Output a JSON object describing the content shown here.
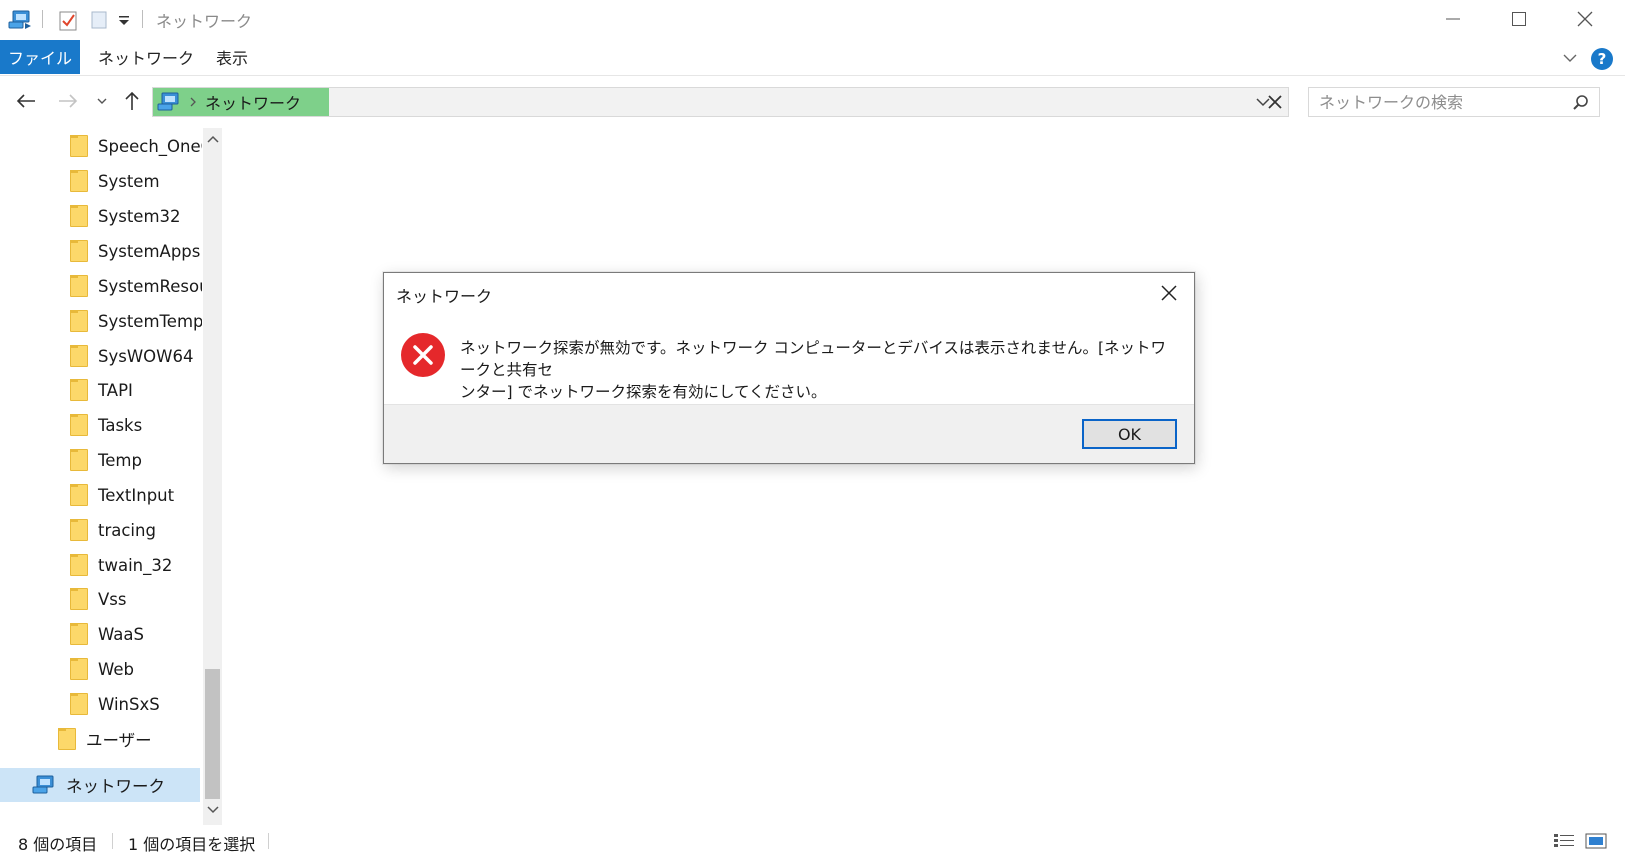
{
  "window": {
    "title": "ネットワーク"
  },
  "ribbon": {
    "tabs": [
      {
        "label": "ファイル",
        "active": true
      },
      {
        "label": "ネットワーク"
      },
      {
        "label": "表示"
      }
    ]
  },
  "navigation": {
    "breadcrumb": "ネットワーク",
    "search_placeholder": "ネットワークの検索"
  },
  "tree": {
    "items": [
      {
        "label": "Speech_OneC"
      },
      {
        "label": "System"
      },
      {
        "label": "System32"
      },
      {
        "label": "SystemApps"
      },
      {
        "label": "SystemResou"
      },
      {
        "label": "SystemTemp"
      },
      {
        "label": "SysWOW64"
      },
      {
        "label": "TAPI"
      },
      {
        "label": "Tasks"
      },
      {
        "label": "Temp"
      },
      {
        "label": "TextInput"
      },
      {
        "label": "tracing"
      },
      {
        "label": "twain_32"
      },
      {
        "label": "Vss"
      },
      {
        "label": "WaaS"
      },
      {
        "label": "Web"
      },
      {
        "label": "WinSxS"
      },
      {
        "label": "ユーザー"
      }
    ],
    "network_label": "ネットワーク"
  },
  "status": {
    "item_count": "8 個の項目",
    "selected": "1 個の項目を選択"
  },
  "dialog": {
    "title": "ネットワーク",
    "message_line1": "ネットワーク探索が無効です。ネットワーク コンピューターとデバイスは表示されません。[ネットワークと共有セ",
    "message_line2": "ンター] でネットワーク探索を有効にしてください。",
    "ok_label": "OK",
    "icon": "error-icon"
  },
  "colors": {
    "accent": "#1979ca",
    "breadcrumb_highlight": "#7ed08a",
    "error": "#e5282b"
  }
}
